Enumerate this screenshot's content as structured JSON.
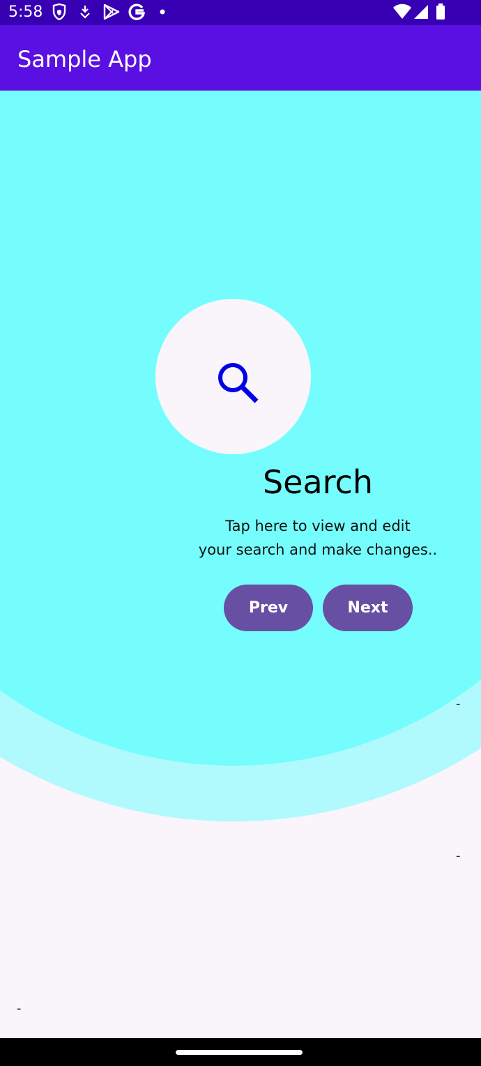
{
  "status_bar": {
    "time": "5:58",
    "left_icons": [
      "shield-icon",
      "download-arrow-icon",
      "play-store-icon",
      "google-icon",
      "dot-icon"
    ],
    "right_icons": [
      "wifi-icon",
      "signal-icon",
      "battery-icon"
    ],
    "background": "#3700b3"
  },
  "app_bar": {
    "title": "Sample App",
    "background": "#5a10e2"
  },
  "showcase": {
    "icon": "search-icon",
    "icon_color": "#0000e6",
    "title": "Search",
    "description_line1": "Tap here to view and edit",
    "description_line2": "your search and make changes..",
    "prev_label": "Prev",
    "next_label": "Next",
    "button_color": "#6750a4",
    "inner_color": "#75fdfd",
    "outer_color": "#b0fafd"
  },
  "list_markers": [
    "-",
    "-",
    "-"
  ]
}
